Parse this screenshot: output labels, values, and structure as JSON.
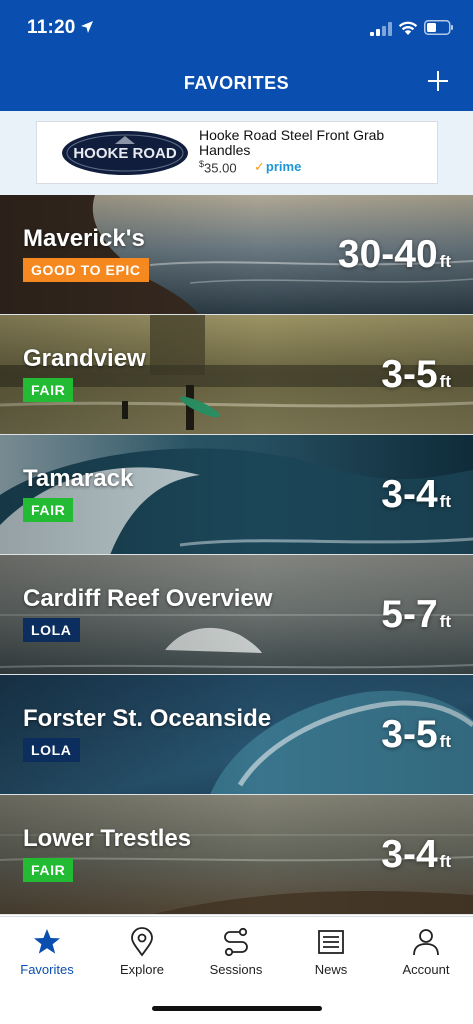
{
  "status_bar": {
    "time": "11:20"
  },
  "header": {
    "title": "FAVORITES",
    "add_icon": "plus-icon"
  },
  "ad": {
    "logo_text": "HOOKE ROAD",
    "title": "Hooke Road Steel Front Grab Handles",
    "price": "35.00",
    "currency": "$",
    "prime_label": "prime"
  },
  "spots": [
    {
      "name": "Maverick's",
      "rating": "GOOD TO EPIC",
      "rating_color": "#f5881f",
      "height": "30-40",
      "unit": "ft"
    },
    {
      "name": "Grandview",
      "rating": "FAIR",
      "rating_color": "#22bb33",
      "height": "3-5",
      "unit": "ft"
    },
    {
      "name": "Tamarack",
      "rating": "FAIR",
      "rating_color": "#22bb33",
      "height": "3-4",
      "unit": "ft"
    },
    {
      "name": "Cardiff Reef Overview",
      "rating": "LOLA",
      "rating_color": "#0c2e5f",
      "height": "5-7",
      "unit": "ft"
    },
    {
      "name": "Forster St. Oceanside",
      "rating": "LOLA",
      "rating_color": "#0c2e5f",
      "height": "3-5",
      "unit": "ft"
    },
    {
      "name": "Lower Trestles",
      "rating": "FAIR",
      "rating_color": "#22bb33",
      "height": "3-4",
      "unit": "ft"
    }
  ],
  "tabs": [
    {
      "label": "Favorites",
      "icon": "star-icon",
      "active": true
    },
    {
      "label": "Explore",
      "icon": "map-pin-icon",
      "active": false
    },
    {
      "label": "Sessions",
      "icon": "route-icon",
      "active": false
    },
    {
      "label": "News",
      "icon": "newspaper-icon",
      "active": false
    },
    {
      "label": "Account",
      "icon": "user-icon",
      "active": false
    }
  ],
  "colors": {
    "brand_blue": "#0a4fb0",
    "good_to_epic": "#f5881f",
    "fair": "#22bb33",
    "lola": "#0c2e5f"
  }
}
